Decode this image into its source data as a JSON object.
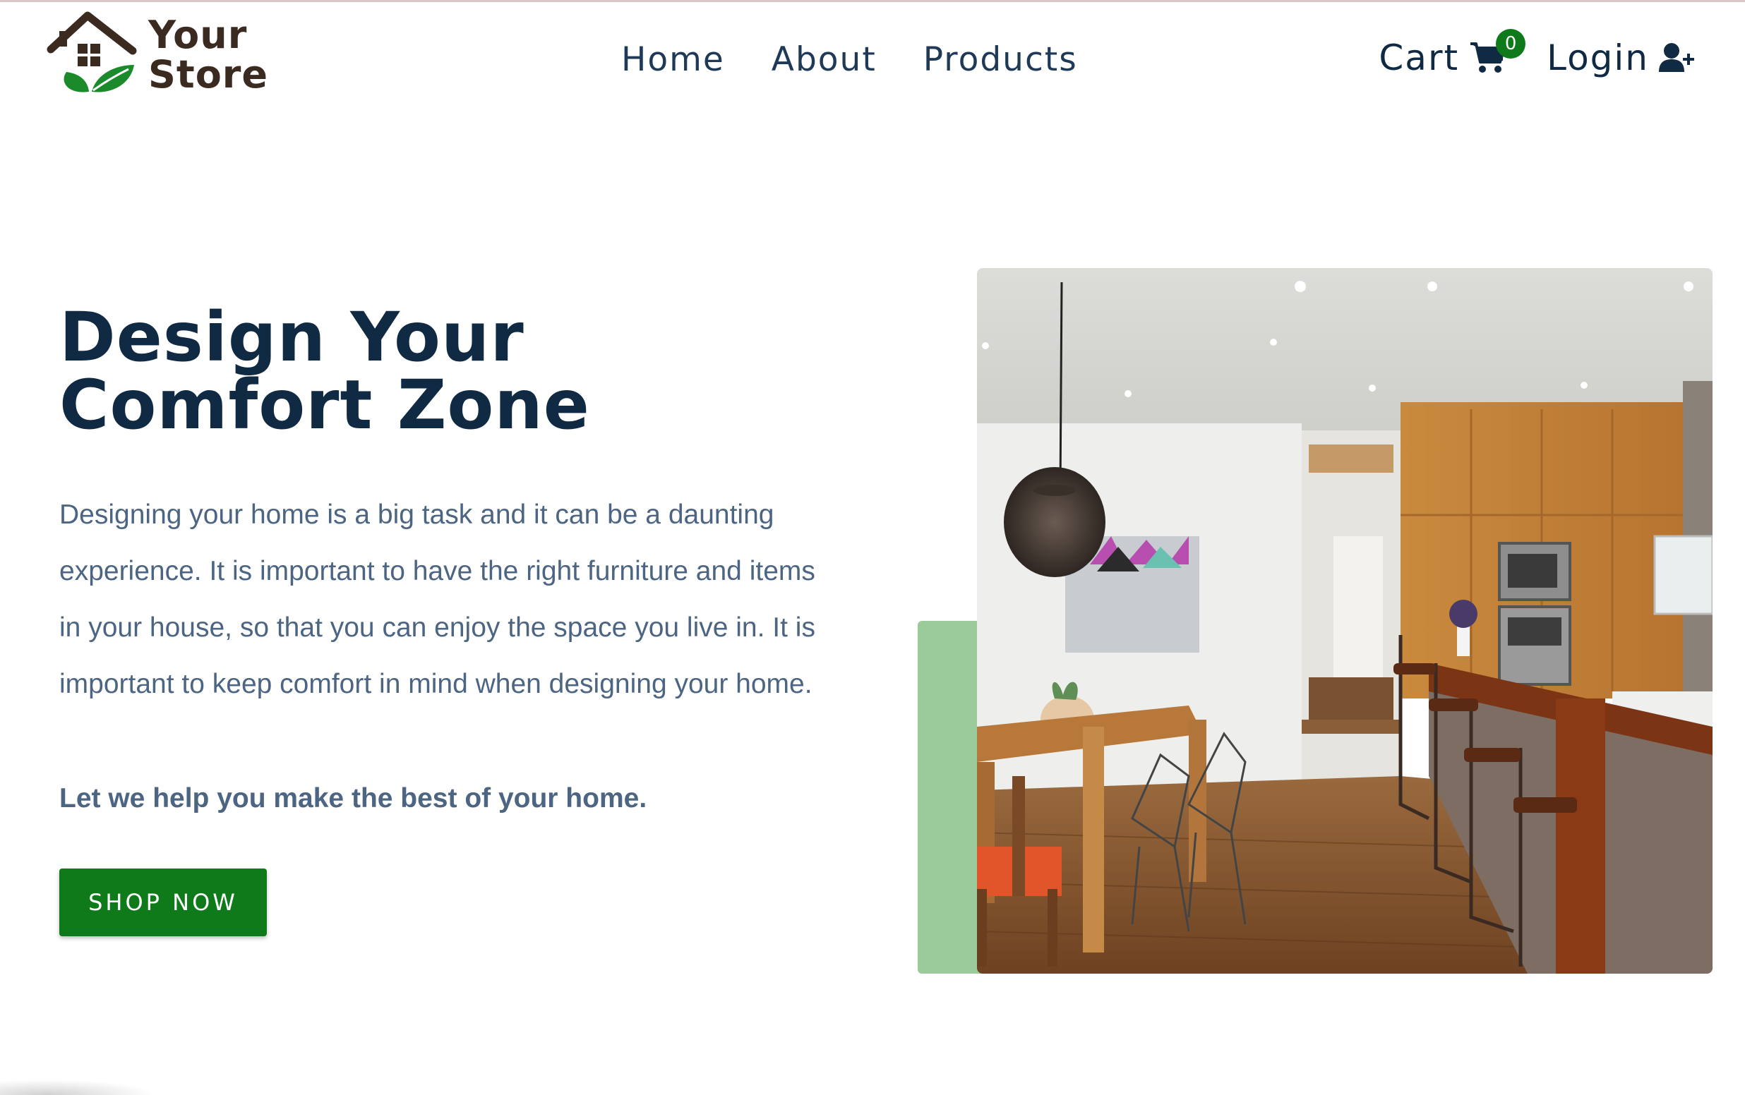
{
  "brand": {
    "line1": "Your",
    "line2": "Store",
    "colors": {
      "text": "#3b2a20",
      "leaf": "#1a8a2a"
    }
  },
  "nav": {
    "links": [
      "Home",
      "About",
      "Products"
    ],
    "cart": {
      "label": "Cart",
      "count": "0",
      "icon": "shopping-cart-icon"
    },
    "login": {
      "label": "Login",
      "icon": "user-plus-icon"
    }
  },
  "hero": {
    "title_line1": "Design Your",
    "title_line2": "Comfort Zone",
    "description": "Designing your home is a big task and it can be a daunting experience. It is important to have the right furniture and items in your house, so that you can enjoy the space you live in. It is important to keep comfort in mind when designing your home.",
    "tagline": "Let we help you make the best of your home.",
    "cta": "SHOP NOW"
  },
  "colors": {
    "primary": "#0f7a1a",
    "heading": "#102a43",
    "body": "#4c6583",
    "accent_block": "#9bcb9a"
  }
}
